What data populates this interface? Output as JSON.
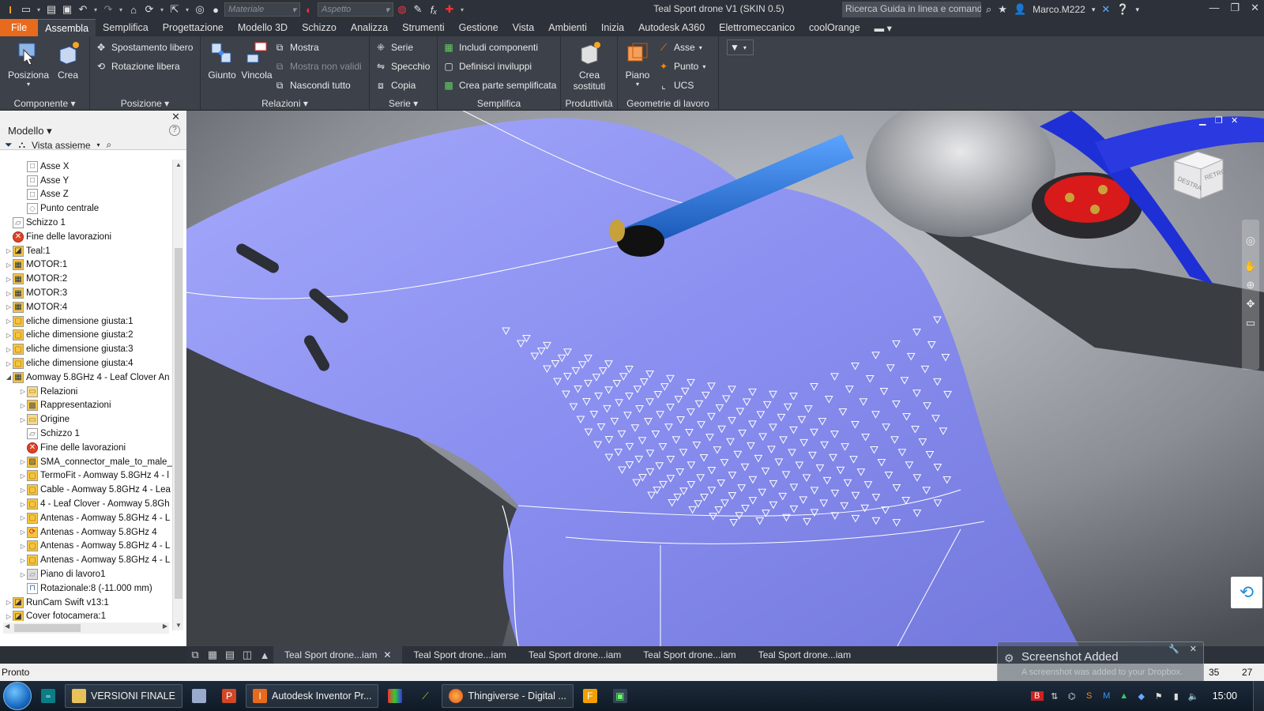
{
  "window": {
    "title": "Teal Sport drone V1 (SKIN 0.5)",
    "material_placeholder": "Materiale",
    "appearance_placeholder": "Aspetto",
    "search_text": "Ricerca Guida in linea e comand",
    "user": "Marco.M222"
  },
  "tabs": [
    "File",
    "Assembla",
    "Semplifica",
    "Progettazione",
    "Modello 3D",
    "Schizzo",
    "Analizza",
    "Strumenti",
    "Gestione",
    "Vista",
    "Ambienti",
    "Inizia",
    "Autodesk A360",
    "Elettromeccanico",
    "coolOrange"
  ],
  "ribbon": {
    "componente": {
      "title": "Componente",
      "posiziona": "Posiziona",
      "crea": "Crea"
    },
    "posizione": {
      "title": "Posizione",
      "spostamento": "Spostamento libero",
      "rotazione": "Rotazione libera"
    },
    "relazioni": {
      "title": "Relazioni",
      "giunto": "Giunto",
      "vincola": "Vincola",
      "mostra": "Mostra",
      "mostra_non_validi": "Mostra non validi",
      "nascondi": "Nascondi tutto"
    },
    "serie": {
      "title": "Serie",
      "serie": "Serie",
      "specchio": "Specchio",
      "copia": "Copia"
    },
    "semplifica": {
      "title": "Semplifica",
      "includi": "Includi componenti",
      "definisci": "Definisci inviluppi",
      "crea_parte": "Crea parte semplificata"
    },
    "produttivita": {
      "title": "Produttività",
      "crea_sostituti_1": "Crea",
      "crea_sostituti_2": "sostituti"
    },
    "geometrie": {
      "title": "Geometrie di lavoro",
      "piano": "Piano",
      "asse": "Asse",
      "punto": "Punto",
      "ucs": "UCS"
    }
  },
  "browser": {
    "title": "Modello",
    "view": "Vista assieme",
    "nodes": [
      {
        "label": "Asse X",
        "indent": 2,
        "expander": "",
        "icon": "axis"
      },
      {
        "label": "Asse Y",
        "indent": 2,
        "expander": "",
        "icon": "axis"
      },
      {
        "label": "Asse Z",
        "indent": 2,
        "expander": "",
        "icon": "axis"
      },
      {
        "label": "Punto centrale",
        "indent": 2,
        "expander": "",
        "icon": "point"
      },
      {
        "label": "Schizzo 1",
        "indent": 1,
        "expander": "",
        "icon": "sketch"
      },
      {
        "label": "Fine delle lavorazioni",
        "indent": 1,
        "expander": "",
        "icon": "eop"
      },
      {
        "label": "Teal:1",
        "indent": 1,
        "expander": ">",
        "icon": "part-flex"
      },
      {
        "label": "MOTOR:1",
        "indent": 1,
        "expander": ">",
        "icon": "assembly"
      },
      {
        "label": "MOTOR:2",
        "indent": 1,
        "expander": ">",
        "icon": "assembly"
      },
      {
        "label": "MOTOR:3",
        "indent": 1,
        "expander": ">",
        "icon": "assembly"
      },
      {
        "label": "MOTOR:4",
        "indent": 1,
        "expander": ">",
        "icon": "assembly"
      },
      {
        "label": "eliche dimensione giusta:1",
        "indent": 1,
        "expander": ">",
        "icon": "part"
      },
      {
        "label": "eliche dimensione giusta:2",
        "indent": 1,
        "expander": ">",
        "icon": "part"
      },
      {
        "label": "eliche dimensione giusta:3",
        "indent": 1,
        "expander": ">",
        "icon": "part"
      },
      {
        "label": "eliche dimensione giusta:4",
        "indent": 1,
        "expander": ">",
        "icon": "part"
      },
      {
        "label": "Aomway 5.8GHz 4 - Leaf Clover An",
        "indent": 1,
        "expander": "v",
        "icon": "assembly"
      },
      {
        "label": "Relazioni",
        "indent": 2,
        "expander": ">",
        "icon": "folder"
      },
      {
        "label": "Rappresentazioni",
        "indent": 2,
        "expander": ">",
        "icon": "reps"
      },
      {
        "label": "Origine",
        "indent": 2,
        "expander": ">",
        "icon": "folder"
      },
      {
        "label": "Schizzo 1",
        "indent": 2,
        "expander": "",
        "icon": "sketch"
      },
      {
        "label": "Fine delle lavorazioni",
        "indent": 2,
        "expander": "",
        "icon": "eop"
      },
      {
        "label": "SMA_connector_male_to_male_",
        "indent": 2,
        "expander": ">",
        "icon": "part-hatch"
      },
      {
        "label": "TermoFit - Aomway 5.8GHz 4 - l",
        "indent": 2,
        "expander": ">",
        "icon": "part"
      },
      {
        "label": "Cable - Aomway 5.8GHz 4 - Lea",
        "indent": 2,
        "expander": ">",
        "icon": "part"
      },
      {
        "label": "4 - Leaf Clover - Aomway 5.8Gh",
        "indent": 2,
        "expander": ">",
        "icon": "part"
      },
      {
        "label": "Antenas - Aomway 5.8GHz 4 - L",
        "indent": 2,
        "expander": ">",
        "icon": "part"
      },
      {
        "label": "Antenas - Aomway 5.8GHz 4",
        "indent": 2,
        "expander": ">",
        "icon": "part-update"
      },
      {
        "label": "Antenas - Aomway 5.8GHz 4 - L",
        "indent": 2,
        "expander": ">",
        "icon": "part"
      },
      {
        "label": "Antenas - Aomway 5.8GHz 4 - L",
        "indent": 2,
        "expander": ">",
        "icon": "part"
      },
      {
        "label": "Piano di lavoro1",
        "indent": 2,
        "expander": ">",
        "icon": "workplane"
      },
      {
        "label": "Rotazionale:8 (-11.000 mm)",
        "indent": 2,
        "expander": "",
        "icon": "constraint"
      },
      {
        "label": "RunCam Swift v13:1",
        "indent": 1,
        "expander": ">",
        "icon": "part-flex"
      },
      {
        "label": "Cover fotocamera:1",
        "indent": 1,
        "expander": ">",
        "icon": "part-flex"
      }
    ]
  },
  "doc_tabs": [
    "Teal Sport drone...iam",
    "Teal Sport drone...iam",
    "Teal Sport drone...iam",
    "Teal Sport drone...iam",
    "Teal Sport drone...iam"
  ],
  "status": {
    "text": "Pronto",
    "n1": "35",
    "n2": "27"
  },
  "toast": {
    "title": "Screenshot Added",
    "body": "A screenshot was added to your Dropbox."
  },
  "taskbar": {
    "items": [
      "VERSIONI FINALE",
      "Autodesk Inventor Pr...",
      "Thingiverse - Digital ..."
    ],
    "clock": "15:00"
  },
  "viewcube": {
    "faces": [
      "DESTRA",
      "RETRO"
    ]
  },
  "colors": {
    "accent_orange": "#e86a1c",
    "model_surface": "#8a8ff0",
    "propeller_blue": "#1f2fd6",
    "motor_red": "#d81a1a",
    "antenna_blue": "#1e6ed8"
  }
}
